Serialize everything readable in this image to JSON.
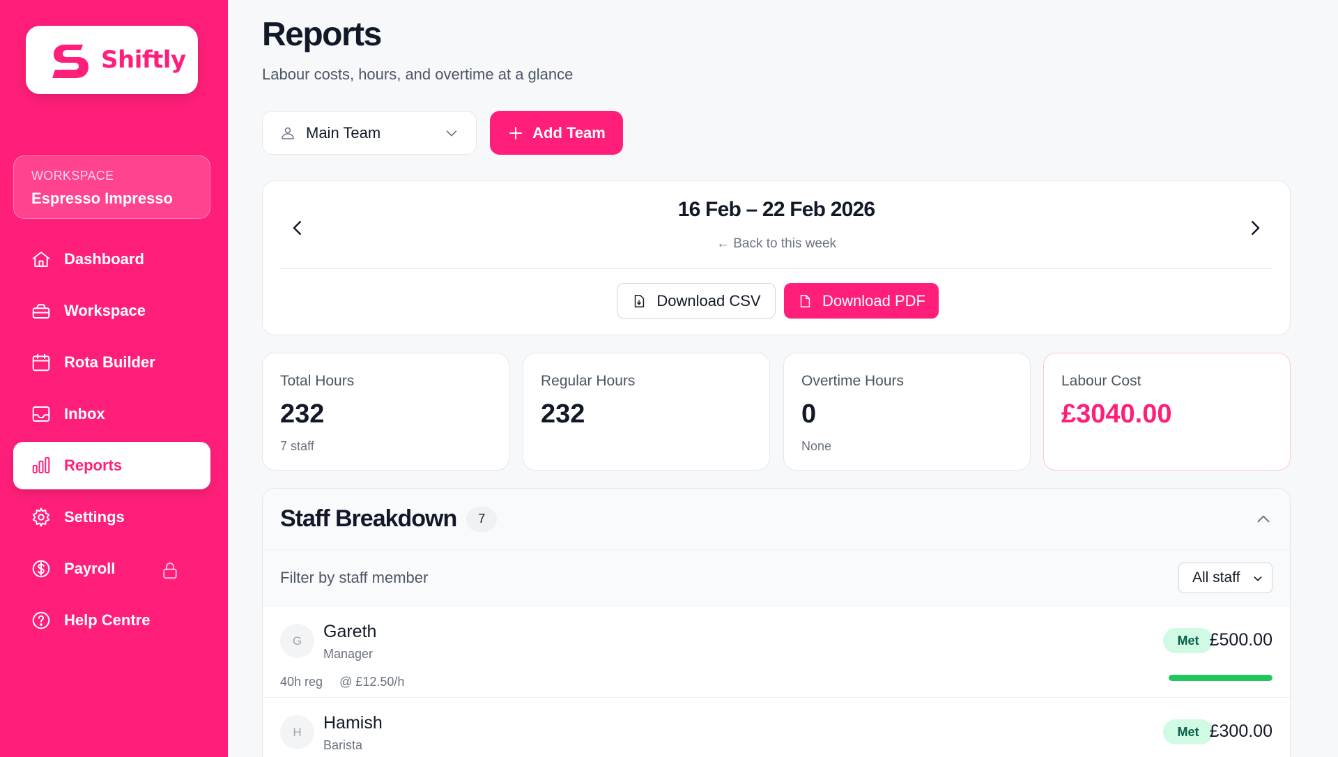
{
  "app": {
    "name": "Shiftly",
    "brand_color": "#ff1f7a"
  },
  "workspace": {
    "label": "WORKSPACE",
    "name": "Espresso Impresso"
  },
  "nav": {
    "items": [
      {
        "label": "Dashboard",
        "icon": "home-icon"
      },
      {
        "label": "Workspace",
        "icon": "briefcase-icon"
      },
      {
        "label": "Rota Builder",
        "icon": "calendar-icon"
      },
      {
        "label": "Inbox",
        "icon": "inbox-icon"
      },
      {
        "label": "Reports",
        "icon": "bar-chart-icon",
        "active": true
      },
      {
        "label": "Settings",
        "icon": "gear-icon"
      },
      {
        "label": "Payroll",
        "icon": "dollar-icon",
        "locked": true
      },
      {
        "label": "Help Centre",
        "icon": "help-icon"
      }
    ]
  },
  "page": {
    "title": "Reports",
    "subtitle": "Labour costs, hours, and overtime at a glance"
  },
  "team_select": {
    "value": "Main Team"
  },
  "add_team": {
    "label": "Add Team"
  },
  "week": {
    "range": "16 Feb – 22 Feb 2026",
    "back_link": "← Back to this week",
    "download_csv": "Download CSV",
    "download_pdf": "Download PDF"
  },
  "stats": [
    {
      "label": "Total Hours",
      "value": "232",
      "sub": "7 staff"
    },
    {
      "label": "Regular Hours",
      "value": "232",
      "sub": ""
    },
    {
      "label": "Overtime Hours",
      "value": "0",
      "sub": "None"
    },
    {
      "label": "Labour Cost",
      "value": "£3040.00",
      "sub": ""
    }
  ],
  "breakdown": {
    "title": "Staff Breakdown",
    "count": "7",
    "filter_label": "Filter by staff member",
    "filter_value": "All staff",
    "staff": [
      {
        "initial": "G",
        "name": "Gareth",
        "role": "Manager",
        "hours": "40h reg",
        "rate": "@ £12.50/h",
        "status": "Met",
        "cost": "£500.00",
        "progress": 1.0
      },
      {
        "initial": "H",
        "name": "Hamish",
        "role": "Barista",
        "hours": "",
        "rate": "",
        "status": "Met",
        "cost": "£300.00",
        "progress": 1.0
      }
    ]
  }
}
